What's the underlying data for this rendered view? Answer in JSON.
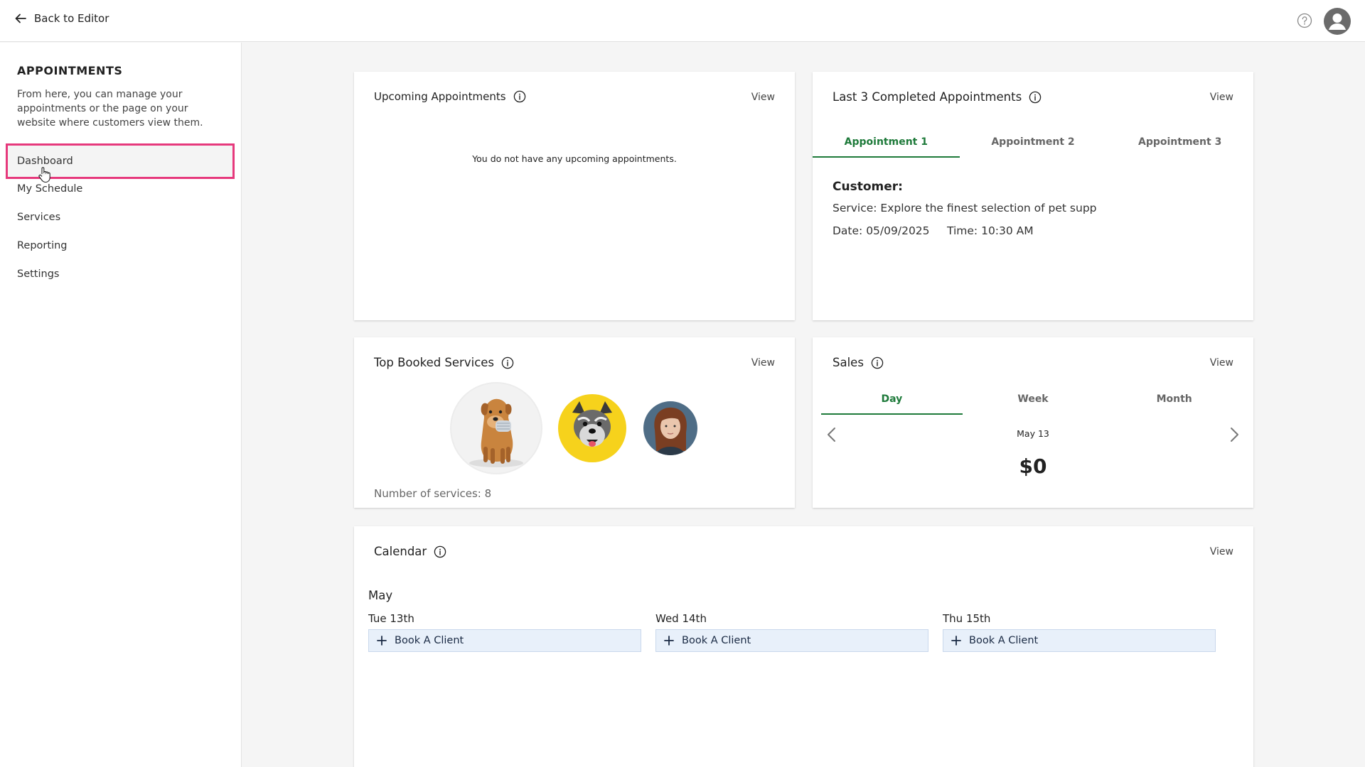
{
  "topbar": {
    "back_label": "Back to Editor"
  },
  "sidebar": {
    "title": "APPOINTMENTS",
    "description": "From here, you can manage your appointments or the page on your website where customers view them.",
    "items": [
      {
        "label": "Dashboard",
        "active": true
      },
      {
        "label": "My Schedule"
      },
      {
        "label": "Services"
      },
      {
        "label": "Reporting"
      },
      {
        "label": "Settings"
      }
    ]
  },
  "upcoming": {
    "title": "Upcoming Appointments",
    "view_label": "View",
    "empty_message": "You do not have any upcoming appointments."
  },
  "completed": {
    "title": "Last 3 Completed Appointments",
    "view_label": "View",
    "tabs": [
      "Appointment 1",
      "Appointment 2",
      "Appointment 3"
    ],
    "active_tab": 0,
    "customer_label": "Customer:",
    "service_line": "Service: Explore the finest selection of pet supp",
    "date_line": "Date: 05/09/2025",
    "time_line": "Time: 10:30 AM"
  },
  "top_services": {
    "title": "Top Booked Services",
    "view_label": "View",
    "count_label": "Number of services: 8"
  },
  "sales": {
    "title": "Sales",
    "view_label": "View",
    "tabs": [
      "Day",
      "Week",
      "Month"
    ],
    "active_tab": 0,
    "date": "May 13",
    "amount": "$0"
  },
  "calendar": {
    "title": "Calendar",
    "view_label": "View",
    "month": "May",
    "days": [
      {
        "label": "Tue 13th",
        "button": "Book A Client"
      },
      {
        "label": "Wed 14th",
        "button": "Book A Client"
      },
      {
        "label": "Thu 15th",
        "button": "Book A Client"
      }
    ]
  },
  "colors": {
    "accent_green": "#1e7a3a",
    "highlight_pink": "#e6397c",
    "book_button_bg": "#e8f0fa"
  }
}
